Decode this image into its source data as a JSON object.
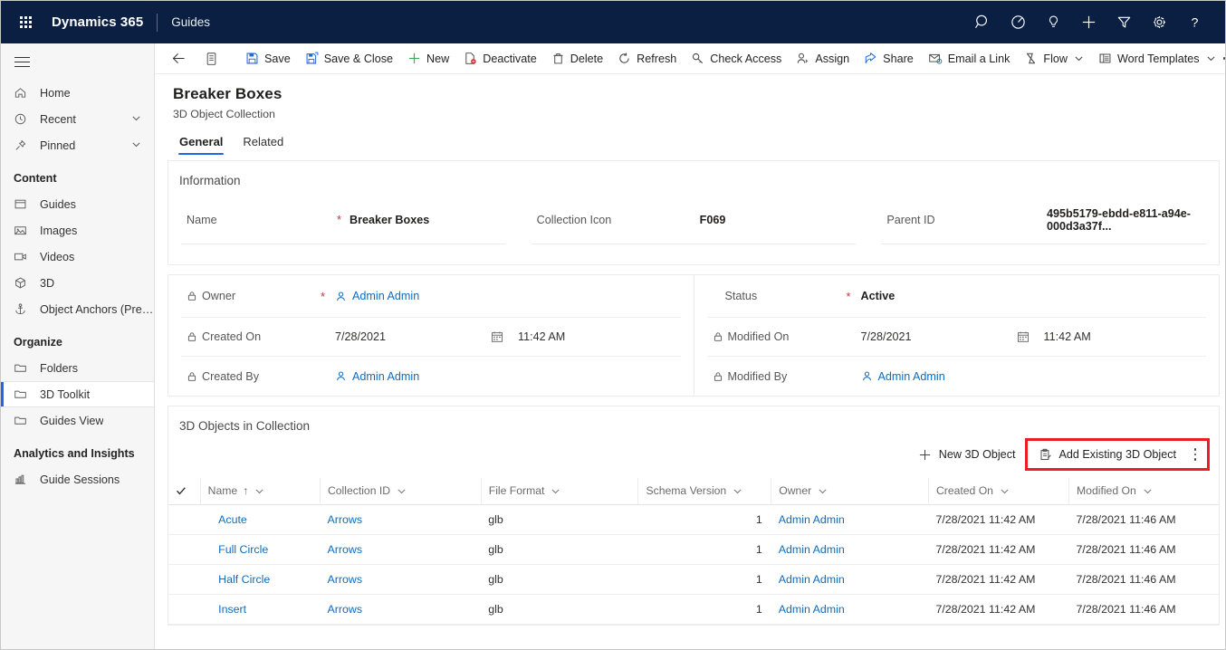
{
  "topnav": {
    "waffle_label": "app-launcher",
    "brand": "Dynamics 365",
    "app_name": "Guides",
    "icons": [
      {
        "name": "search-icon",
        "label": "Search"
      },
      {
        "name": "diagnostics-icon",
        "label": "Diagnostics"
      },
      {
        "name": "lightbulb-icon",
        "label": "Assistant"
      },
      {
        "name": "plus-icon",
        "label": "New"
      },
      {
        "name": "filter-icon",
        "label": "Filter"
      },
      {
        "name": "gear-icon",
        "label": "Settings"
      },
      {
        "name": "help-icon",
        "label": "Help"
      }
    ]
  },
  "sidebar": {
    "hamburger_label": "Expand navigation",
    "items": [
      {
        "label": "Home",
        "icon": "home-icon",
        "chevron": false,
        "selected": false
      },
      {
        "label": "Recent",
        "icon": "clock-icon",
        "chevron": true,
        "selected": false
      },
      {
        "label": "Pinned",
        "icon": "pin-icon",
        "chevron": true,
        "selected": false
      }
    ],
    "group_content": "Content",
    "content_items": [
      {
        "label": "Guides",
        "icon": "guides-icon",
        "selected": false
      },
      {
        "label": "Images",
        "icon": "image-icon",
        "selected": false
      },
      {
        "label": "Videos",
        "icon": "video-icon",
        "selected": false
      },
      {
        "label": "3D",
        "icon": "cube-icon",
        "selected": false
      },
      {
        "label": "Object Anchors (Prev...",
        "icon": "anchor-icon",
        "selected": false
      }
    ],
    "group_organize": "Organize",
    "organize_items": [
      {
        "label": "Folders",
        "icon": "folder-icon",
        "selected": false
      },
      {
        "label": "3D Toolkit",
        "icon": "folder-icon",
        "selected": true
      },
      {
        "label": "Guides View",
        "icon": "folder-icon",
        "selected": false
      }
    ],
    "group_analytics": "Analytics and Insights",
    "analytics_items": [
      {
        "label": "Guide Sessions",
        "icon": "chart-icon",
        "selected": false
      }
    ]
  },
  "commandbar": {
    "back_label": "back-arrow",
    "form_selector_label": "form-selector",
    "items": [
      {
        "label": "Save",
        "icon": "save-icon",
        "chevron": false
      },
      {
        "label": "Save & Close",
        "icon": "save-close-icon",
        "chevron": false
      },
      {
        "label": "New",
        "icon": "plus-icon",
        "chevron": false
      },
      {
        "label": "Deactivate",
        "icon": "deactivate-icon",
        "chevron": false
      },
      {
        "label": "Delete",
        "icon": "trash-icon",
        "chevron": false
      },
      {
        "label": "Refresh",
        "icon": "refresh-icon",
        "chevron": false
      },
      {
        "label": "Check Access",
        "icon": "key-icon",
        "chevron": false
      },
      {
        "label": "Assign",
        "icon": "assign-icon",
        "chevron": false
      },
      {
        "label": "Share",
        "icon": "share-icon",
        "chevron": false
      },
      {
        "label": "Email a Link",
        "icon": "email-icon",
        "chevron": false
      },
      {
        "label": "Flow",
        "icon": "flow-icon",
        "chevron": true
      },
      {
        "label": "Word Templates",
        "icon": "word-icon",
        "chevron": true
      }
    ],
    "overflow_label": "More commands"
  },
  "page": {
    "title": "Breaker Boxes",
    "subtitle": "3D Object Collection",
    "tabs": [
      {
        "label": "General",
        "active": true
      },
      {
        "label": "Related",
        "active": false
      }
    ]
  },
  "information": {
    "section_title": "Information",
    "name_label": "Name",
    "name_value": "Breaker Boxes",
    "name_required": "*",
    "collection_icon_label": "Collection Icon",
    "collection_icon_value": "F069",
    "parent_id_label": "Parent ID",
    "parent_id_value": "495b5179-ebdd-e811-a94e-000d3a37f..."
  },
  "ownership": {
    "owner_label": "Owner",
    "owner_required": "*",
    "owner_value": "Admin Admin",
    "created_on_label": "Created On",
    "created_on_date": "7/28/2021",
    "created_on_time": "11:42 AM",
    "created_by_label": "Created By",
    "created_by_value": "Admin Admin",
    "status_label": "Status",
    "status_required": "*",
    "status_value": "Active",
    "modified_on_label": "Modified On",
    "modified_on_date": "7/28/2021",
    "modified_on_time": "11:42 AM",
    "modified_by_label": "Modified By",
    "modified_by_value": "Admin Admin"
  },
  "subgrid": {
    "title": "3D Objects in Collection",
    "new_button": "New 3D Object",
    "add_existing_button": "Add Existing 3D Object",
    "overflow_label": "More commands",
    "highlight_color": "#ec1c24",
    "columns": [
      {
        "label": "Name",
        "sorted": true,
        "sort_arrow": "↑"
      },
      {
        "label": "Collection ID",
        "sorted": false
      },
      {
        "label": "File Format",
        "sorted": false
      },
      {
        "label": "Schema Version",
        "sorted": false
      },
      {
        "label": "Owner",
        "sorted": false
      },
      {
        "label": "Created On",
        "sorted": false
      },
      {
        "label": "Modified On",
        "sorted": false
      }
    ],
    "rows": [
      {
        "name": "Acute",
        "collection_id": "Arrows",
        "file_format": "glb",
        "schema_version": "1",
        "owner": "Admin Admin",
        "created_on": "7/28/2021 11:42 AM",
        "modified_on": "7/28/2021 11:46 AM"
      },
      {
        "name": "Full Circle",
        "collection_id": "Arrows",
        "file_format": "glb",
        "schema_version": "1",
        "owner": "Admin Admin",
        "created_on": "7/28/2021 11:42 AM",
        "modified_on": "7/28/2021 11:46 AM"
      },
      {
        "name": "Half Circle",
        "collection_id": "Arrows",
        "file_format": "glb",
        "schema_version": "1",
        "owner": "Admin Admin",
        "created_on": "7/28/2021 11:42 AM",
        "modified_on": "7/28/2021 11:46 AM"
      },
      {
        "name": "Insert",
        "collection_id": "Arrows",
        "file_format": "glb",
        "schema_version": "1",
        "owner": "Admin Admin",
        "created_on": "7/28/2021 11:42 AM",
        "modified_on": "7/28/2021 11:46 AM"
      }
    ]
  },
  "colors": {
    "navbar": "#0b1f42",
    "link": "#0f6cbd",
    "accent": "#2266e3",
    "required": "#d13438"
  }
}
